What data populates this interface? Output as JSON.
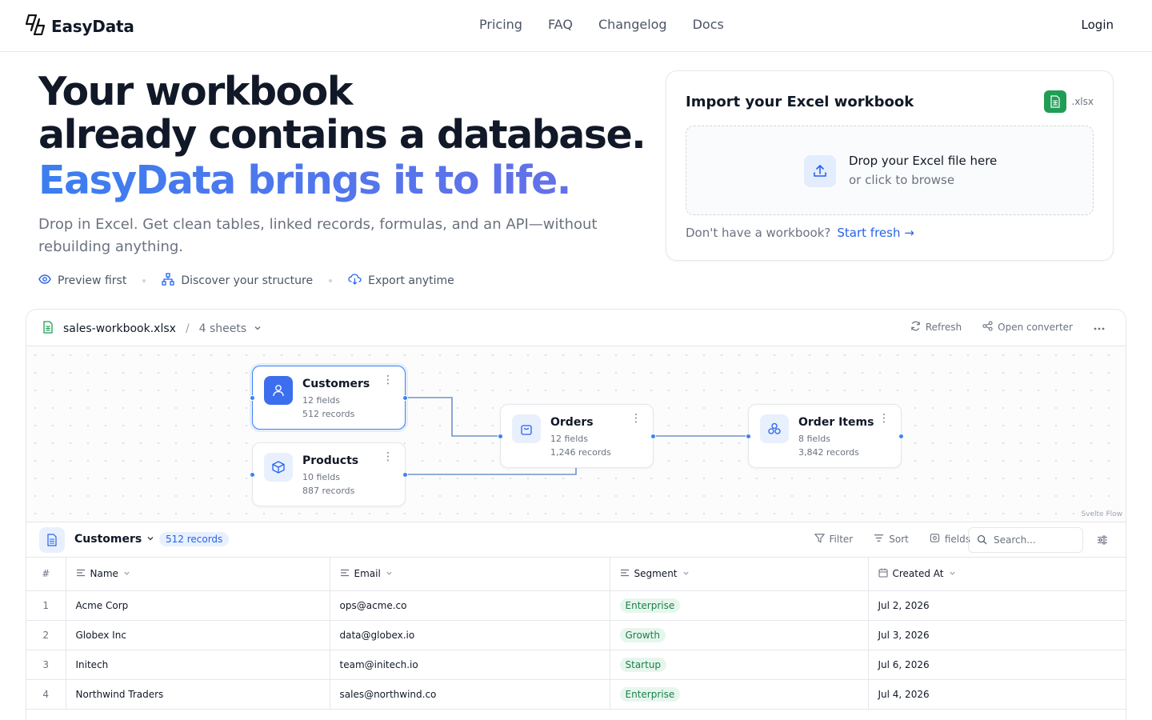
{
  "brand": {
    "name": "EasyData",
    "logo_icon": "lightning-s-logo"
  },
  "nav": {
    "items": [
      "Pricing",
      "FAQ",
      "Changelog",
      "Docs"
    ],
    "login": "Login"
  },
  "hero": {
    "title_line1": "Your workbook",
    "title_line2": "already contains a database.",
    "title_accent": "EasyData brings it to life.",
    "subtitle": "Drop in Excel. Get clean tables, linked records, formulas, and an API—without rebuilding anything.",
    "features": [
      {
        "label": "Preview first",
        "icon": "eye-icon"
      },
      {
        "label": "Discover your structure",
        "icon": "sitemap-icon"
      },
      {
        "label": "Export anytime",
        "icon": "cloud-download-icon"
      }
    ]
  },
  "import_card": {
    "title": "Import your Excel workbook",
    "badge": ".xlsx",
    "drop_main": "Drop your Excel file here",
    "drop_sub": "or click to browse",
    "footer_text": "Don't have a workbook?",
    "footer_link": "Start fresh"
  },
  "workspace": {
    "file_name": "sales-workbook.xlsx",
    "separator": "/",
    "sheets": "4 sheets",
    "actions": {
      "refresh": "Refresh",
      "open_converter": "Open converter"
    },
    "attribution": "Svelte Flow"
  },
  "flow": {
    "nodes": [
      {
        "title": "Customers",
        "fields": "12 fields",
        "records": "512 records",
        "icon": "user-icon"
      },
      {
        "title": "Products",
        "fields": "10 fields",
        "records": "887 records",
        "icon": "box-icon"
      },
      {
        "title": "Orders",
        "fields": "12 fields",
        "records": "1,246 records",
        "icon": "shopping-bag-icon"
      },
      {
        "title": "Order Items",
        "fields": "8 fields",
        "records": "3,842 records",
        "icon": "boxes-icon"
      }
    ]
  },
  "table_view": {
    "sheet": "Customers",
    "records_badge": "512 records",
    "actions": {
      "filter": "Filter",
      "sort": "Sort",
      "fields": "fields"
    },
    "search_placeholder": "Search...",
    "columns": [
      "#",
      "Name",
      "Email",
      "Segment",
      "Created At"
    ],
    "rows": [
      {
        "n": "1",
        "name": "Acme Corp",
        "email": "ops@acme.co",
        "segment": "Enterprise",
        "created": "Jul 2, 2026"
      },
      {
        "n": "2",
        "name": "Globex Inc",
        "email": "data@globex.io",
        "segment": "Growth",
        "created": "Jul 3, 2026"
      },
      {
        "n": "3",
        "name": "Initech",
        "email": "team@initech.io",
        "segment": "Startup",
        "created": "Jul 6, 2026"
      },
      {
        "n": "4",
        "name": "Northwind Traders",
        "email": "sales@northwind.co",
        "segment": "Enterprise",
        "created": "Jul 4, 2026"
      }
    ]
  },
  "colors": {
    "accent": "#3b7ef0",
    "accent_end": "#6a6ee8",
    "edge": "#4a86e8",
    "pill_bg": "#e7f6ed",
    "pill_text": "#1a7f4b",
    "excel_green": "#1f9d55"
  }
}
